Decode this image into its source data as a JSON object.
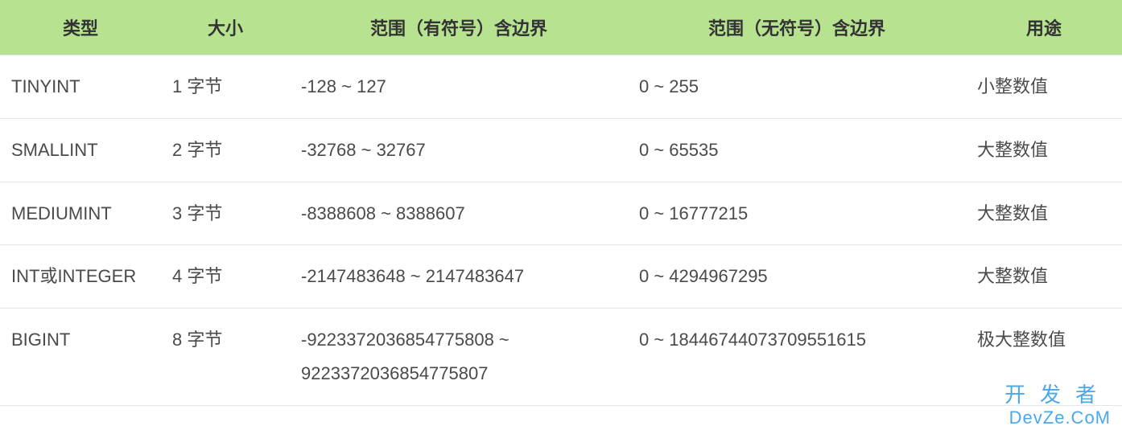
{
  "table": {
    "headers": {
      "type": "类型",
      "size": "大小",
      "signed": "范围（有符号）含边界",
      "unsigned": "范围（无符号）含边界",
      "usage": "用途"
    },
    "rows": [
      {
        "type": "TINYINT",
        "size": "1 字节",
        "signed": "-128 ~ 127",
        "unsigned": "0 ~ 255",
        "usage": "小整数值"
      },
      {
        "type": "SMALLINT",
        "size": "2 字节",
        "signed": "-32768 ~ 32767",
        "unsigned": "0 ~ 65535",
        "usage": "大整数值"
      },
      {
        "type": "MEDIUMINT",
        "size": "3 字节",
        "signed": "-8388608 ~ 8388607",
        "unsigned": "0 ~ 16777215",
        "usage": "大整数值"
      },
      {
        "type": "INT或INTEGER",
        "size": "4 字节",
        "signed": "-2147483648 ~ 2147483647",
        "unsigned": "0 ~ 4294967295",
        "usage": "大整数值"
      },
      {
        "type": "BIGINT",
        "size": "8 字节",
        "signed": "-9223372036854775808 ~ 9223372036854775807",
        "unsigned": "0 ~ 18446744073709551615",
        "usage": "极大整数值"
      }
    ]
  },
  "watermark": {
    "line1": "开发者",
    "line2": "DevZe.CoM"
  }
}
